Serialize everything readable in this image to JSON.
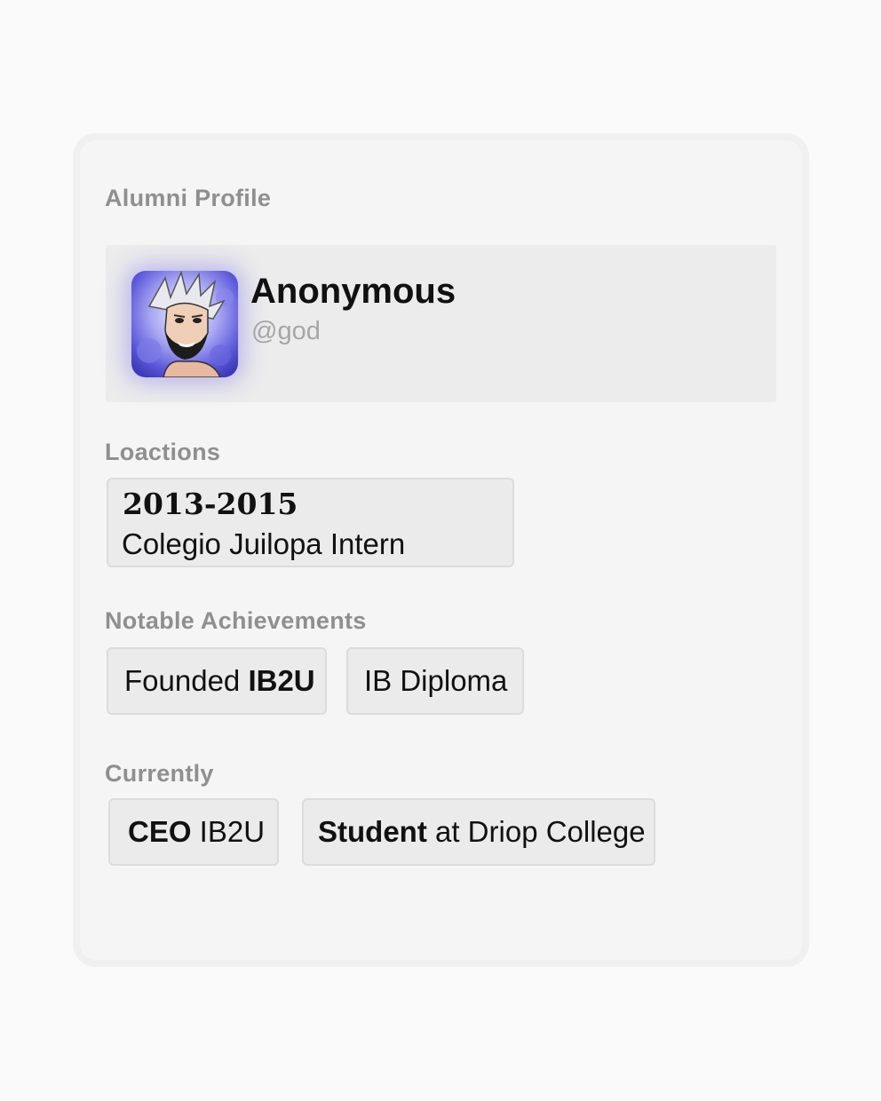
{
  "card": {
    "title": "Alumni Profile"
  },
  "profile": {
    "name": "Anonymous",
    "handle": "@god",
    "avatar_icon": "anime-character-avatar"
  },
  "locations": {
    "label": "Loactions",
    "items": [
      {
        "years": "2013-2015",
        "place": "Colegio Juilopa Intern"
      }
    ]
  },
  "achievements": {
    "label": "Notable Achievements",
    "items": [
      {
        "prefix": "Founded ",
        "bold": "IB2U",
        "suffix": ""
      },
      {
        "prefix": "IB Diploma",
        "bold": "",
        "suffix": ""
      }
    ]
  },
  "currently": {
    "label": "Currently",
    "items": [
      {
        "prefix": "",
        "bold": "CEO",
        "suffix": " IB2U"
      },
      {
        "prefix": "",
        "bold": "Student",
        "suffix": " at Driop College"
      }
    ]
  },
  "colors": {
    "page_background": "#fafafa",
    "card_background": "#f5f5f5",
    "label_gray": "#8f8f8f",
    "handle_gray": "#a6a6a6",
    "chip_background": "#ebebeb",
    "avatar_glow": "#786ee6"
  }
}
